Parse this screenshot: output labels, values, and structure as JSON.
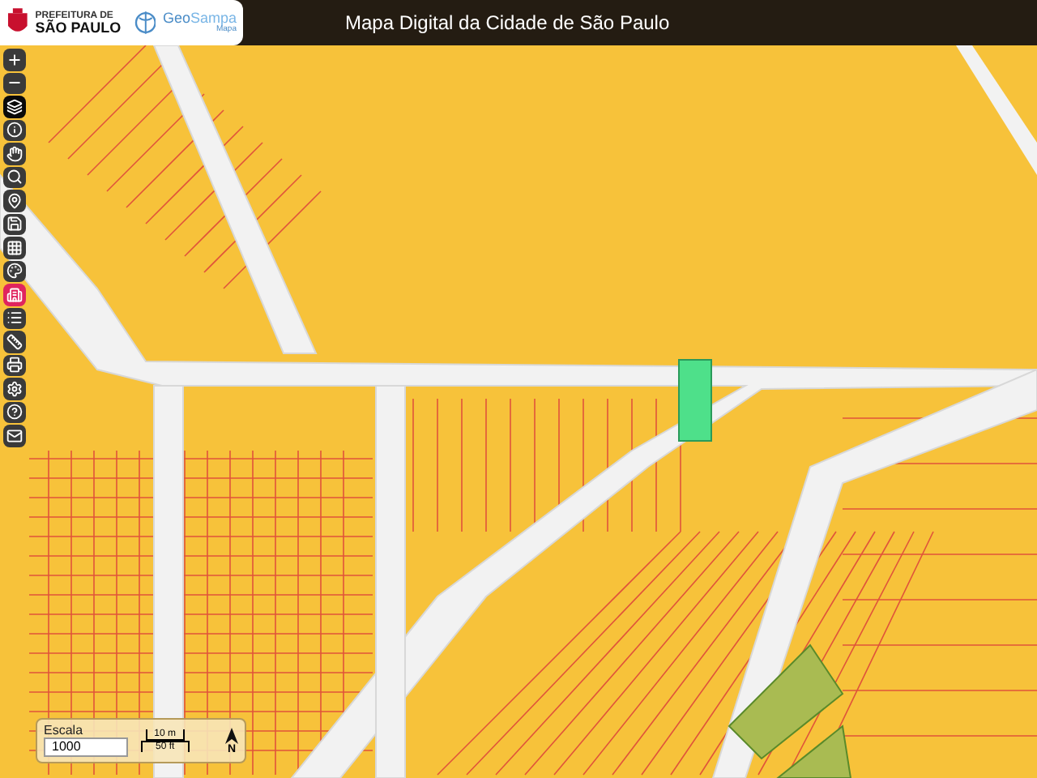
{
  "header": {
    "city_logo": {
      "line_1": "PREFEITURA DE",
      "line_2": "SÃO PAULO"
    },
    "app_logo": {
      "name_part_1": "Geo",
      "name_part_2": "Sampa",
      "subtitle": "Mapa"
    },
    "title": "Mapa Digital da Cidade de São Paulo"
  },
  "toolbar": [
    {
      "kind": "plus",
      "color": "#3a3a3a"
    },
    {
      "kind": "minus",
      "color": "#3a3a3a"
    },
    {
      "kind": "layers",
      "color": "#0a0a0a"
    },
    {
      "kind": "info",
      "color": "#3a3a3a"
    },
    {
      "kind": "hand",
      "color": "#3a3a3a"
    },
    {
      "kind": "search",
      "color": "#3a3a3a"
    },
    {
      "kind": "pin",
      "color": "#3a3a3a"
    },
    {
      "kind": "save",
      "color": "#3a3a3a"
    },
    {
      "kind": "grid",
      "color": "#3a3a3a"
    },
    {
      "kind": "palette",
      "color": "#3a3a3a"
    },
    {
      "kind": "building",
      "color": "#e0245e"
    },
    {
      "kind": "list",
      "color": "#3a3a3a"
    },
    {
      "kind": "measure",
      "color": "#3a3a3a"
    },
    {
      "kind": "print",
      "color": "#3a3a3a"
    },
    {
      "kind": "settings",
      "color": "#3a3a3a"
    },
    {
      "kind": "help",
      "color": "#3a3a3a"
    },
    {
      "kind": "mail",
      "color": "#3a3a3a"
    }
  ],
  "scale": {
    "label": "Escala",
    "value": "1000",
    "bar_top": "10 m",
    "bar_bottom": "50 ft",
    "north": "N"
  }
}
